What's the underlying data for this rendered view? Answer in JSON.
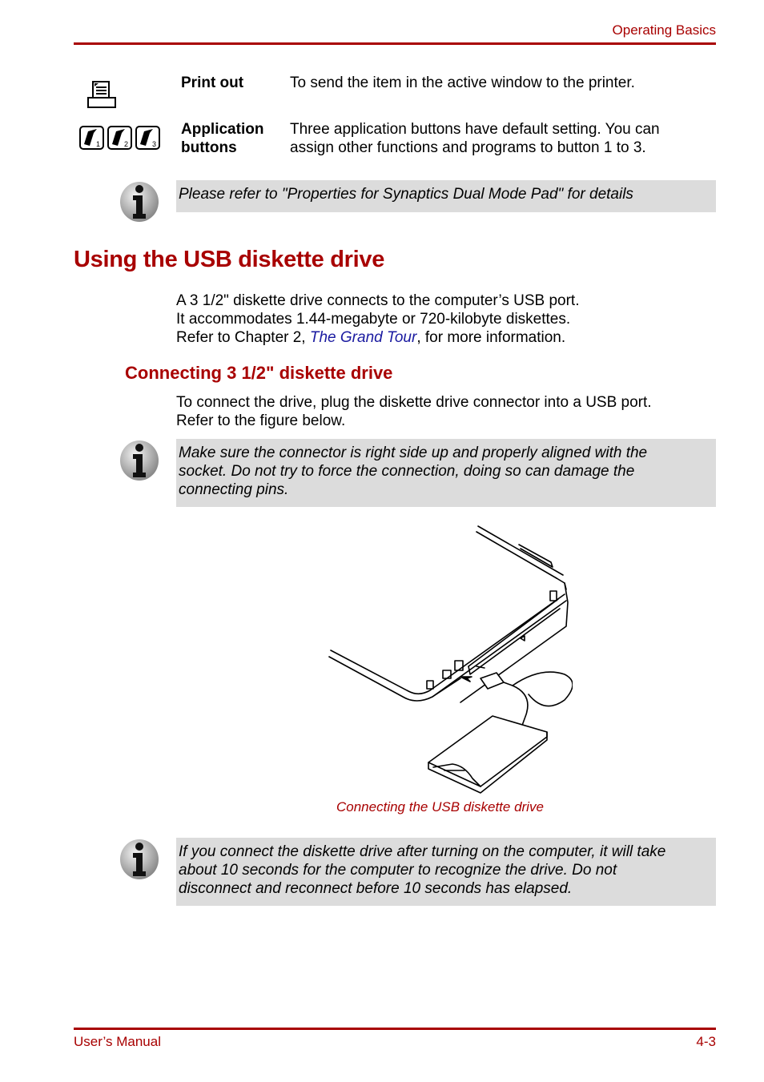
{
  "header": {
    "section": "Operating Basics"
  },
  "table": {
    "rows": [
      {
        "icon": "printer-icon",
        "label": "Print out",
        "description": "To send the item in the active window to the printer."
      },
      {
        "icon": "application-buttons-icon",
        "label_line1": "Application",
        "label_line2": "buttons",
        "description_line1": "Three application buttons have default setting. You can",
        "description_line2": "assign other functions and programs to button 1 to 3."
      }
    ],
    "app_button_numbers": [
      "1",
      "2",
      "3"
    ]
  },
  "notes": [
    {
      "icon": "info-icon",
      "lines": [
        "Please refer to \"Properties for Synaptics Dual Mode Pad\" for details"
      ]
    },
    {
      "icon": "info-icon",
      "lines": [
        "Make sure the connector is right side up and properly aligned with the",
        "socket. Do not try to force the connection, doing so can damage the",
        "connecting pins."
      ]
    },
    {
      "icon": "info-icon",
      "lines": [
        "If you connect the diskette drive after turning on the computer, it will take",
        "about 10 seconds for the computer to recognize the drive. Do not",
        "disconnect and reconnect before 10 seconds has elapsed."
      ]
    }
  ],
  "section": {
    "title": "Using the USB diskette drive",
    "para": {
      "line1": "A 3 1/2\" diskette drive connects to the computer’s USB port.",
      "line2": "It accommodates 1.44-megabyte or 720-kilobyte diskettes.",
      "line3_pre": "Refer to Chapter 2, ",
      "line3_link": "The Grand Tour",
      "line3_post": ", for more information."
    },
    "subsection": {
      "title": "Connecting 3 1/2\" diskette drive",
      "line1": "To connect the drive, plug the diskette drive connector into a USB port.",
      "line2": "Refer to the figure below."
    }
  },
  "figure": {
    "caption": "Connecting the USB diskette drive"
  },
  "footer": {
    "left": "User’s Manual",
    "right": "4-3"
  }
}
